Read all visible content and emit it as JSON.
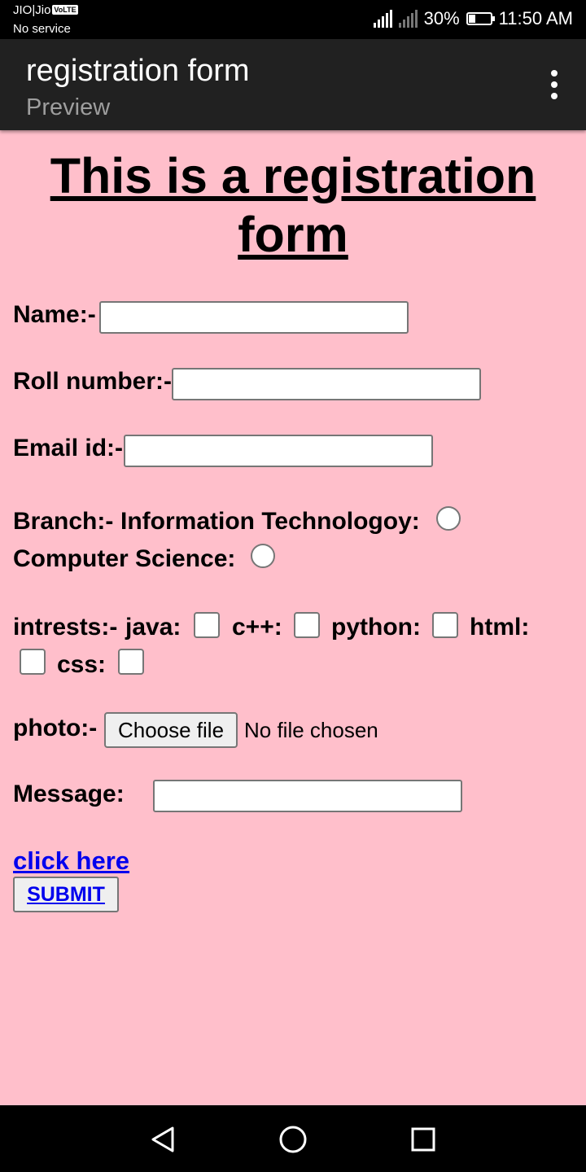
{
  "status_bar": {
    "carrier": "JIO|Jio",
    "volte": "VoLTE",
    "service": "No service",
    "battery_percent_text": "30%",
    "battery_level": 0.3,
    "time": "11:50 AM"
  },
  "app_bar": {
    "title": "registration form",
    "subtitle": "Preview",
    "menu_icon": "more-vert-icon"
  },
  "form": {
    "heading": "This is a registration form",
    "name_label": "Name:-",
    "name_value": "",
    "roll_label": "Roll number:-",
    "roll_value": "",
    "email_label": "Email id:-",
    "email_value": "",
    "branch_label": "Branch:-",
    "branch_options": [
      "Information Technologoy:",
      "Computer Science:"
    ],
    "branch_selected": null,
    "interests_label": "intrests:-",
    "interest_options": [
      "java:",
      "c++:",
      "python:",
      "html:",
      "css:"
    ],
    "interests_checked": [
      false,
      false,
      false,
      false,
      false
    ],
    "photo_label": "photo:-",
    "file_button": "Choose file",
    "file_status": "No file chosen",
    "message_label": "Message:",
    "message_value": "",
    "link_text": "click here",
    "submit_label": "SUBMIT"
  },
  "nav_bar": {
    "icons": [
      "back-icon",
      "home-icon",
      "recents-icon"
    ]
  },
  "colors": {
    "page_background": "#ffbfcb",
    "app_bar": "#212121",
    "link": "#0000ee"
  }
}
